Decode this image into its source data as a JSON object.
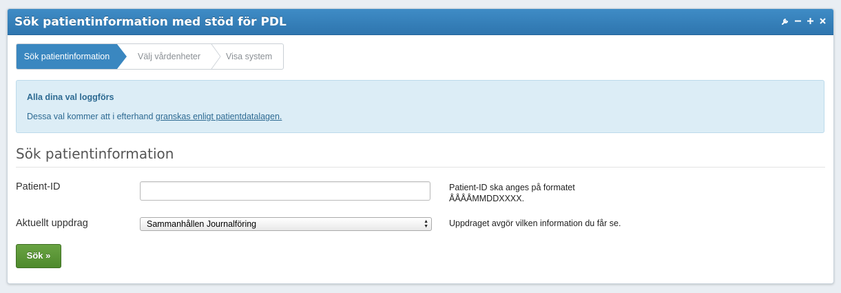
{
  "window": {
    "title": "Sök patientinformation med stöd för PDL",
    "controls": [
      "wrench-icon",
      "minimize-icon",
      "maximize-icon",
      "close-icon"
    ],
    "accent_color": "#3a87c0"
  },
  "wizard": {
    "steps": [
      {
        "label": "Sök patientinformation",
        "active": true
      },
      {
        "label": "Välj vårdenheter",
        "active": false
      },
      {
        "label": "Visa system",
        "active": false
      }
    ]
  },
  "info": {
    "heading": "Alla dina val loggförs",
    "text": "Dessa val kommer att i efterhand",
    "link": "granskas enligt patientdatalagen."
  },
  "form": {
    "section_title": "Sök patientinformation",
    "patient_id": {
      "label": "Patient-ID",
      "value": "",
      "help_line1": "Patient-ID ska anges på formatet",
      "help_line2": "ÅÅÅÅMMDDXXXX."
    },
    "assignment": {
      "label": "Aktuellt uppdrag",
      "selected": "Sammanhållen Journalföring",
      "help": "Uppdraget avgör vilken information du får se."
    },
    "search_button": "Sök »",
    "button_color": "#5a9535"
  }
}
